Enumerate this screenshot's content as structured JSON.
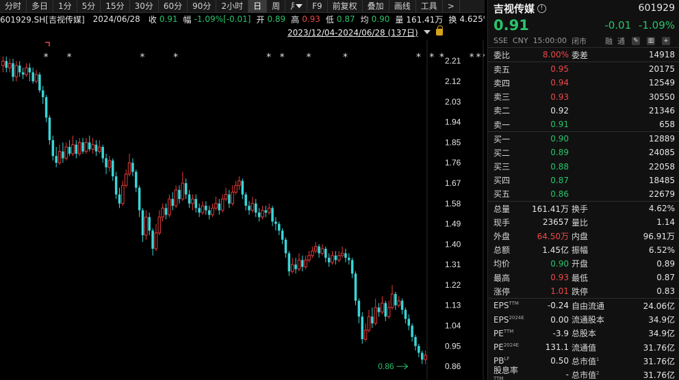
{
  "toolbar": {
    "items": [
      "分时",
      "多日",
      "1分",
      "5分",
      "15分",
      "30分",
      "60分",
      "90分",
      "2小时",
      "日",
      "周",
      "月",
      "F9",
      "前复权",
      "叠加",
      "画线",
      "工具",
      ">"
    ],
    "active": "日"
  },
  "info": {
    "code": "601929.SH[吉视传媒]",
    "date": "2024/06/28",
    "close_label": "收",
    "close": "0.91",
    "change_label": "幅",
    "change": "-1.09%[-0.01]",
    "open_label": "开",
    "open": "0.89",
    "high_label": "高",
    "high": "0.93",
    "low_label": "低",
    "low": "0.87",
    "avg_label": "均",
    "avg": "0.90",
    "volume_label": "量",
    "volume": "161.41万",
    "turnover_label": "换",
    "turnover": "4.625%"
  },
  "range": "2023/12/04-2024/06/28 (137日)",
  "chart_data": {
    "type": "candlestick",
    "ylim": [
      0.83,
      2.25
    ],
    "yticks": [
      "2.21",
      "2.12",
      "2.03",
      "1.94",
      "1.85",
      "1.76",
      "1.67",
      "1.58",
      "1.49",
      "1.40",
      "1.31",
      "1.22",
      "1.13",
      "1.04",
      "0.95",
      "0.86"
    ],
    "last_label": "0.86",
    "marker_positions": [
      13,
      20,
      42,
      52,
      80,
      84,
      92,
      103,
      125,
      129,
      132,
      141,
      143,
      145,
      147
    ],
    "up_color": "#e83b3b",
    "down_color": "#3ad6d8",
    "candles": [
      [
        2.19,
        2.21,
        2.23,
        2.16
      ],
      [
        2.21,
        2.18,
        2.23,
        2.16
      ],
      [
        2.18,
        2.2,
        2.22,
        2.16
      ],
      [
        2.2,
        2.14,
        2.22,
        2.12
      ],
      [
        2.14,
        2.19,
        2.21,
        2.12
      ],
      [
        2.19,
        2.16,
        2.21,
        2.14
      ],
      [
        2.16,
        2.15,
        2.18,
        2.13
      ],
      [
        2.15,
        2.18,
        2.2,
        2.14
      ],
      [
        2.18,
        2.16,
        2.2,
        2.12
      ],
      [
        2.16,
        2.12,
        2.18,
        2.11
      ],
      [
        2.12,
        2.15,
        2.17,
        2.11
      ],
      [
        2.15,
        2.08,
        2.16,
        2.07
      ],
      [
        2.08,
        2.05,
        2.1,
        2.02
      ],
      [
        2.05,
        1.96,
        2.06,
        1.94
      ],
      [
        1.96,
        1.86,
        1.97,
        1.84
      ],
      [
        1.86,
        1.79,
        1.88,
        1.77
      ],
      [
        1.79,
        1.76,
        1.83,
        1.74
      ],
      [
        1.76,
        1.81,
        1.84,
        1.75
      ],
      [
        1.81,
        1.78,
        1.85,
        1.76
      ],
      [
        1.78,
        1.83,
        1.85,
        1.77
      ],
      [
        1.83,
        1.8,
        1.86,
        1.79
      ],
      [
        1.8,
        1.84,
        1.88,
        1.79
      ],
      [
        1.84,
        1.8,
        1.86,
        1.78
      ],
      [
        1.8,
        1.85,
        1.87,
        1.79
      ],
      [
        1.85,
        1.81,
        1.87,
        1.8
      ],
      [
        1.81,
        1.85,
        1.87,
        1.8
      ],
      [
        1.85,
        1.82,
        1.88,
        1.81
      ],
      [
        1.82,
        1.84,
        1.87,
        1.8
      ],
      [
        1.84,
        1.81,
        1.86,
        1.79
      ],
      [
        1.81,
        1.83,
        1.86,
        1.8
      ],
      [
        1.83,
        1.78,
        1.84,
        1.76
      ],
      [
        1.78,
        1.74,
        1.8,
        1.71
      ],
      [
        1.74,
        1.77,
        1.79,
        1.72
      ],
      [
        1.77,
        1.7,
        1.78,
        1.68
      ],
      [
        1.7,
        1.62,
        1.72,
        1.6
      ],
      [
        1.62,
        1.58,
        1.65,
        1.56
      ],
      [
        1.58,
        1.66,
        1.68,
        1.57
      ],
      [
        1.66,
        1.71,
        1.73,
        1.65
      ],
      [
        1.71,
        1.76,
        1.8,
        1.7
      ],
      [
        1.76,
        1.72,
        1.78,
        1.7
      ],
      [
        1.72,
        1.65,
        1.73,
        1.63
      ],
      [
        1.65,
        1.55,
        1.66,
        1.52
      ],
      [
        1.55,
        1.44,
        1.56,
        1.41
      ],
      [
        1.44,
        1.52,
        1.55,
        1.42
      ],
      [
        1.52,
        1.46,
        1.54,
        1.44
      ],
      [
        1.46,
        1.38,
        1.47,
        1.35
      ],
      [
        1.38,
        1.45,
        1.49,
        1.37
      ],
      [
        1.45,
        1.52,
        1.55,
        1.44
      ],
      [
        1.52,
        1.56,
        1.58,
        1.5
      ],
      [
        1.56,
        1.53,
        1.58,
        1.51
      ],
      [
        1.53,
        1.6,
        1.62,
        1.52
      ],
      [
        1.6,
        1.57,
        1.63,
        1.55
      ],
      [
        1.57,
        1.64,
        1.66,
        1.56
      ],
      [
        1.64,
        1.6,
        1.66,
        1.58
      ],
      [
        1.6,
        1.67,
        1.72,
        1.59
      ],
      [
        1.67,
        1.62,
        1.69,
        1.6
      ],
      [
        1.62,
        1.58,
        1.64,
        1.56
      ],
      [
        1.58,
        1.6,
        1.62,
        1.55
      ],
      [
        1.6,
        1.56,
        1.62,
        1.54
      ],
      [
        1.56,
        1.54,
        1.58,
        1.52
      ],
      [
        1.54,
        1.57,
        1.59,
        1.53
      ],
      [
        1.57,
        1.55,
        1.59,
        1.53
      ],
      [
        1.55,
        1.53,
        1.57,
        1.51
      ],
      [
        1.53,
        1.56,
        1.58,
        1.52
      ],
      [
        1.56,
        1.58,
        1.61,
        1.55
      ],
      [
        1.58,
        1.55,
        1.6,
        1.53
      ],
      [
        1.55,
        1.6,
        1.62,
        1.54
      ],
      [
        1.6,
        1.62,
        1.65,
        1.59
      ],
      [
        1.62,
        1.58,
        1.64,
        1.56
      ],
      [
        1.58,
        1.63,
        1.66,
        1.57
      ],
      [
        1.63,
        1.66,
        1.68,
        1.62
      ],
      [
        1.66,
        1.68,
        1.7,
        1.64
      ],
      [
        1.68,
        1.62,
        1.69,
        1.6
      ],
      [
        1.62,
        1.57,
        1.63,
        1.55
      ],
      [
        1.57,
        1.55,
        1.59,
        1.53
      ],
      [
        1.55,
        1.58,
        1.61,
        1.54
      ],
      [
        1.58,
        1.54,
        1.6,
        1.52
      ],
      [
        1.54,
        1.52,
        1.56,
        1.5
      ],
      [
        1.52,
        1.55,
        1.57,
        1.51
      ],
      [
        1.55,
        1.54,
        1.57,
        1.52
      ],
      [
        1.54,
        1.56,
        1.58,
        1.53
      ],
      [
        1.56,
        1.5,
        1.57,
        1.48
      ],
      [
        1.5,
        1.49,
        1.52,
        1.46
      ],
      [
        1.49,
        1.46,
        1.5,
        1.44
      ],
      [
        1.46,
        1.42,
        1.47,
        1.4
      ],
      [
        1.42,
        1.36,
        1.43,
        1.34
      ],
      [
        1.36,
        1.28,
        1.37,
        1.26
      ],
      [
        1.28,
        1.31,
        1.34,
        1.27
      ],
      [
        1.31,
        1.29,
        1.34,
        1.27
      ],
      [
        1.29,
        1.33,
        1.36,
        1.28
      ],
      [
        1.33,
        1.3,
        1.35,
        1.28
      ],
      [
        1.3,
        1.33,
        1.35,
        1.29
      ],
      [
        1.33,
        1.35,
        1.37,
        1.32
      ],
      [
        1.35,
        1.37,
        1.39,
        1.34
      ],
      [
        1.37,
        1.39,
        1.41,
        1.36
      ],
      [
        1.39,
        1.36,
        1.4,
        1.34
      ],
      [
        1.36,
        1.38,
        1.4,
        1.35
      ],
      [
        1.38,
        1.34,
        1.39,
        1.32
      ],
      [
        1.34,
        1.32,
        1.36,
        1.3
      ],
      [
        1.32,
        1.35,
        1.37,
        1.31
      ],
      [
        1.35,
        1.33,
        1.37,
        1.31
      ],
      [
        1.33,
        1.35,
        1.37,
        1.32
      ],
      [
        1.35,
        1.36,
        1.39,
        1.34
      ],
      [
        1.36,
        1.34,
        1.38,
        1.32
      ],
      [
        1.34,
        1.33,
        1.36,
        1.31
      ],
      [
        1.33,
        1.27,
        1.34,
        1.25
      ],
      [
        1.27,
        1.15,
        1.28,
        1.13
      ],
      [
        1.15,
        1.08,
        1.16,
        1.05
      ],
      [
        1.08,
        0.98,
        1.1,
        0.96
      ],
      [
        0.98,
        1.02,
        1.05,
        0.97
      ],
      [
        1.02,
        1.08,
        1.11,
        1.01
      ],
      [
        1.08,
        1.05,
        1.12,
        1.03
      ],
      [
        1.05,
        1.12,
        1.16,
        1.04
      ],
      [
        1.12,
        1.1,
        1.14,
        1.08
      ],
      [
        1.1,
        1.14,
        1.17,
        1.09
      ],
      [
        1.14,
        1.08,
        1.15,
        1.06
      ],
      [
        1.08,
        1.12,
        1.15,
        1.07
      ],
      [
        1.12,
        1.18,
        1.22,
        1.11
      ],
      [
        1.18,
        1.13,
        1.19,
        1.11
      ],
      [
        1.13,
        1.15,
        1.17,
        1.12
      ],
      [
        1.15,
        1.11,
        1.16,
        1.09
      ],
      [
        1.11,
        1.07,
        1.12,
        1.05
      ],
      [
        1.07,
        1.04,
        1.09,
        1.02
      ],
      [
        1.04,
        0.99,
        1.05,
        0.97
      ],
      [
        0.99,
        0.95,
        1.0,
        0.93
      ],
      [
        0.95,
        0.92,
        0.96,
        0.9
      ],
      [
        0.92,
        0.89,
        0.93,
        0.87
      ],
      [
        0.89,
        0.91,
        0.93,
        0.87
      ]
    ]
  },
  "quote": {
    "name": "吉视传媒",
    "code": "601929",
    "price": "0.91",
    "change": "-0.01",
    "change_pct": "-1.09%",
    "meta": [
      "SSE",
      "CNY",
      "15:00:00",
      "闭市",
      "融",
      "通"
    ],
    "ratio": {
      "l1": "委比",
      "v1": "8.00%",
      "l2": "委差",
      "v2": "14918"
    },
    "sell": [
      {
        "label": "卖五",
        "price": "0.95",
        "vol": "20175",
        "dir": "up"
      },
      {
        "label": "卖四",
        "price": "0.94",
        "vol": "12549",
        "dir": "up"
      },
      {
        "label": "卖三",
        "price": "0.93",
        "vol": "30550",
        "dir": "up"
      },
      {
        "label": "卖二",
        "price": "0.92",
        "vol": "21346",
        "dir": "neutral"
      },
      {
        "label": "卖一",
        "price": "0.91",
        "vol": "658",
        "dir": "down"
      }
    ],
    "buy": [
      {
        "label": "买一",
        "price": "0.90",
        "vol": "12889",
        "dir": "down"
      },
      {
        "label": "买二",
        "price": "0.89",
        "vol": "24085",
        "dir": "down"
      },
      {
        "label": "买三",
        "price": "0.88",
        "vol": "22058",
        "dir": "down"
      },
      {
        "label": "买四",
        "price": "0.87",
        "vol": "18485",
        "dir": "down"
      },
      {
        "label": "买五",
        "price": "0.86",
        "vol": "22679",
        "dir": "down"
      }
    ],
    "stats": [
      {
        "l1": "总量",
        "v1": "161.41万",
        "d1": "neutral",
        "l2": "换手",
        "v2": "4.62%",
        "d2": "neutral"
      },
      {
        "l1": "现手",
        "v1": "23657",
        "d1": "neutral",
        "l2": "量比",
        "v2": "1.14",
        "d2": "neutral"
      },
      {
        "l1": "外盘",
        "v1": "64.50万",
        "d1": "up",
        "l2": "内盘",
        "v2": "96.91万",
        "d2": "down"
      },
      {
        "l1": "总额",
        "v1": "1.45亿",
        "d1": "neutral",
        "l2": "振幅",
        "v2": "6.52%",
        "d2": "neutral"
      },
      {
        "l1": "均价",
        "v1": "0.90",
        "d1": "down",
        "l2": "开盘",
        "v2": "0.89",
        "d2": "down"
      },
      {
        "l1": "最高",
        "v1": "0.93",
        "d1": "up",
        "l2": "最低",
        "v2": "0.87",
        "d2": "down"
      },
      {
        "l1": "涨停",
        "v1": "1.01",
        "d1": "up",
        "l2": "跌停",
        "v2": "0.83",
        "d2": "down"
      }
    ],
    "fund": [
      {
        "l1": "EPS",
        "s1": "TTM",
        "v1": "-0.24",
        "l2": "自由流通",
        "s2": "",
        "v2": "24.06亿"
      },
      {
        "l1": "EPS",
        "s1": "2024E",
        "v1": "0.00",
        "l2": "流通股本",
        "s2": "",
        "v2": "34.9亿"
      },
      {
        "l1": "PE",
        "s1": "TTM",
        "v1": "-3.9",
        "l2": "总股本",
        "s2": "",
        "v2": "34.9亿"
      },
      {
        "l1": "PE",
        "s1": "2024E",
        "v1": "131.1",
        "l2": "流通值",
        "s2": "",
        "v2": "31.76亿"
      },
      {
        "l1": "PB",
        "s1": "LF",
        "v1": "0.50",
        "l2": "总市值",
        "s2": "1",
        "v2": "31.76亿"
      },
      {
        "l1": "股息率",
        "s1": "TTM",
        "v1": "-",
        "l2": "总市值",
        "s2": "2",
        "v2": "31.76亿"
      }
    ]
  }
}
